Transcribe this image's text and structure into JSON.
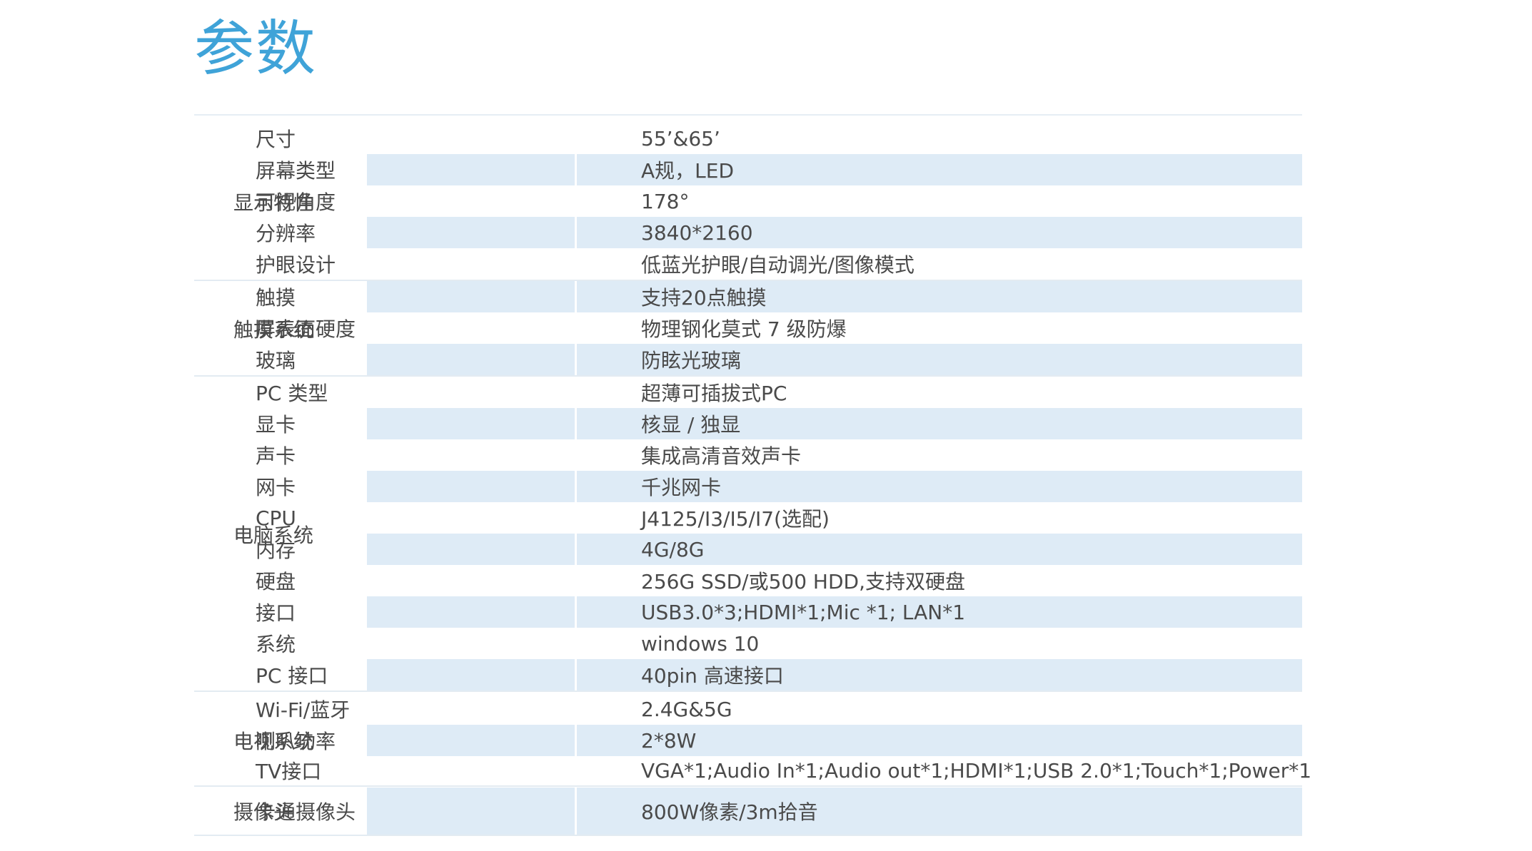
{
  "title": "参数",
  "groups": [
    {
      "label": "显示特性",
      "rows": [
        {
          "param": "尺寸",
          "value": "55’&65’"
        },
        {
          "param": "屏幕类型",
          "value": "A规，LED"
        },
        {
          "param": "可视角度",
          "value": "178°"
        },
        {
          "param": "分辨率",
          "value": "3840*2160"
        },
        {
          "param": "护眼设计",
          "value": "低蓝光护眼/自动调光/图像模式"
        }
      ]
    },
    {
      "label": "触摸系统",
      "rows": [
        {
          "param": "触摸",
          "value": "支持20点触摸"
        },
        {
          "param": "屏表面硬度",
          "value": "物理钢化莫式 7 级防爆"
        },
        {
          "param": "玻璃",
          "value": "防眩光玻璃"
        }
      ]
    },
    {
      "label": "电脑系统",
      "rows": [
        {
          "param": "PC 类型",
          "value": "超薄可插拔式PC"
        },
        {
          "param": "显卡",
          "value": "核显 / 独显"
        },
        {
          "param": "声卡",
          "value": "集成高清音效声卡"
        },
        {
          "param": "网卡",
          "value": "千兆网卡"
        },
        {
          "param": "CPU",
          "value": "J4125/I3/I5/I7(选配)"
        },
        {
          "param": "内存",
          "value": "4G/8G"
        },
        {
          "param": "硬盘",
          "value": "256G SSD/或500 HDD,支持双硬盘"
        },
        {
          "param": "接口",
          "value": "USB3.0*3;HDMI*1;Mic *1; LAN*1"
        },
        {
          "param": "系统",
          "value": "windows 10"
        },
        {
          "param": "PC 接口",
          "value": "40pin 高速接口"
        }
      ]
    },
    {
      "label": "电视系统",
      "rows": [
        {
          "param": "Wi-Fi/蓝牙",
          "value": "2.4G&5G"
        },
        {
          "param": "喇叭功率",
          "value": "2*8W"
        },
        {
          "param": "TV接口",
          "value": "VGA*1;Audio In*1;Audio out*1;HDMI*1;USB 2.0*1;Touch*1;Power*1"
        }
      ]
    },
    {
      "label": "摄像头",
      "rows": [
        {
          "param": "卡通摄像头",
          "value": "800W像素/3m拾音"
        }
      ]
    }
  ],
  "colors": {
    "title": "#3fa3d8",
    "row_shade": "#deebf6",
    "text": "#4a4a4a",
    "rule": "#e3ebf2"
  }
}
